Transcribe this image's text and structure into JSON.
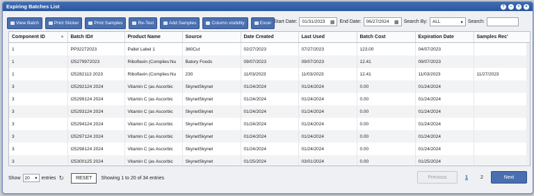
{
  "window": {
    "title": "Expiring Batches List"
  },
  "toolbar": {
    "view_batch": "View Batch",
    "print_sticker": "Print Sticker",
    "print_samples": "Print Samples",
    "re_test": "Re-Test",
    "add_samples": "Add Samples",
    "column_visibility": "Column visibility",
    "excel": "Excel"
  },
  "filters": {
    "start_label": "Start Date:",
    "start_value": "01/31/2023",
    "end_label": "End Date:",
    "end_value": "06/27/2024",
    "search_by_label": "Search By:",
    "search_by_value": "ALL",
    "search_label": "Search:"
  },
  "table": {
    "headers": [
      "Component ID",
      "Batch ID#",
      "Product Name",
      "Source",
      "Date Created",
      "Last Used",
      "Batch Cost",
      "Expiration Date",
      "Samples Rec'"
    ],
    "rows": [
      [
        "1",
        "PP32272023",
        "Pallet Label 1",
        "360Cut",
        "02/27/2023",
        "07/27/2023",
        "123.00",
        "04/07/2023",
        ""
      ],
      [
        "1",
        "I25279972023",
        "Riboflavin (Complies:Nu",
        "Batory Foods",
        "09/07/2023",
        "09/07/2023",
        "12.41",
        "09/07/2023",
        ""
      ],
      [
        "1",
        "I25282113 2023",
        "Riboflavin (Complies:Nu",
        "230",
        "11/03/2023",
        "11/03/2023",
        "12.41",
        "11/03/2023",
        "11/27/2023"
      ],
      [
        "3",
        "I25292124 2024",
        "Vitamin C (as Ascorbic",
        "SkynetSkynet",
        "01/24/2024",
        "01/24/2024",
        "0.00",
        "01/24/2024",
        ""
      ],
      [
        "3",
        "I25299124 2024",
        "Vitamin C (as Ascorbic",
        "SkynetSkynet",
        "01/24/2024",
        "01/24/2024",
        "0.00",
        "01/24/2024",
        ""
      ],
      [
        "3",
        "I25293124 2024",
        "Vitamin C (as Ascorbic",
        "SkynetSkynet",
        "01/24/2024",
        "01/24/2024",
        "0.00",
        "01/24/2024",
        ""
      ],
      [
        "3",
        "I25294124 2024",
        "Vitamin C (as Ascorbic",
        "SkynetSkynet",
        "01/24/2024",
        "01/24/2024",
        "0.00",
        "01/24/2024",
        ""
      ],
      [
        "3",
        "I25297124 2024",
        "Vitamin C (as Ascorbic",
        "SkynetSkynet",
        "01/24/2024",
        "01/24/2024",
        "0.00",
        "01/24/2024",
        ""
      ],
      [
        "3",
        "I25298124 2024",
        "Vitamin C (as Ascorbic",
        "SkynetSkynet",
        "01/24/2024",
        "01/24/2024",
        "0.00",
        "01/24/2024",
        ""
      ],
      [
        "3",
        "I25300125 2024",
        "Vitamin C (as Ascorbic",
        "SkynetSkynet",
        "01/25/2024",
        "03/01/2024",
        "0.00",
        "01/25/2024",
        ""
      ]
    ]
  },
  "footer": {
    "show_label": "Show",
    "length_value": "20",
    "entries_label": "entries",
    "reset_label": "RESET",
    "info": "Showing 1 to 20 of 34 entries",
    "prev_label": "Previous",
    "pages": [
      "1",
      "2"
    ],
    "next_label": "Next"
  }
}
